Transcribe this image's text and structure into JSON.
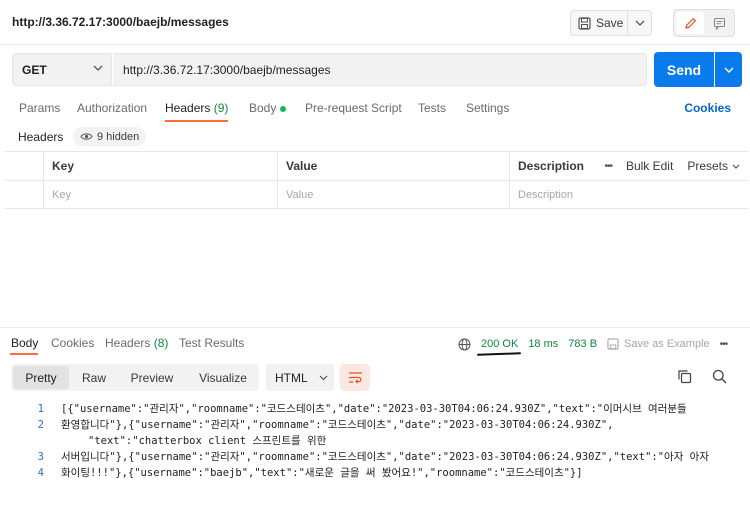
{
  "request": {
    "title": "http://3.36.72.17:3000/baejb/messages",
    "save_label": "Save",
    "method": "GET",
    "url": "http://3.36.72.17:3000/baejb/messages",
    "send_label": "Send"
  },
  "tabs": {
    "params": "Params",
    "authorization": "Authorization",
    "headers_label": "Headers",
    "headers_count": "(9)",
    "body": "Body",
    "pre_request": "Pre-request Script",
    "tests": "Tests",
    "settings": "Settings",
    "cookies": "Cookies"
  },
  "headers_sub": {
    "label": "Headers",
    "hidden": "9 hidden"
  },
  "header_table": {
    "col_key": "Key",
    "col_value": "Value",
    "col_description": "Description",
    "more": "•••",
    "bulk_edit": "Bulk Edit",
    "presets": "Presets",
    "key_placeholder": "Key",
    "value_placeholder": "Value",
    "description_placeholder": "Description"
  },
  "response": {
    "tabs": {
      "body": "Body",
      "cookies": "Cookies",
      "headers_label": "Headers",
      "headers_count": "(8)",
      "test_results": "Test Results"
    },
    "status": "200 OK",
    "time": "18 ms",
    "size": "783 B",
    "save_example": "Save as Example",
    "more": "•••",
    "views": {
      "pretty": "Pretty",
      "raw": "Raw",
      "preview": "Preview",
      "visualize": "Visualize"
    },
    "format": "HTML",
    "lines": [
      {
        "num": "1",
        "text": "[{\"username\":\"관리자\",\"roomname\":\"코드스테이츠\",\"date\":\"2023-03-30T04:06:24.930Z\",\"text\":\"이머시브 여러분들"
      },
      {
        "num": "",
        "text": "환영합니다\"},{\"username\":\"관리자\",\"roomname\":\"코드스테이츠\",\"date\":\"2023-03-30T04:06:24.930Z\","
      },
      {
        "num": "",
        "text": "\"text\":\"chatterbox client 스프린트를 위한"
      },
      {
        "num": "",
        "text": "서버입니다\"},{\"username\":\"관리자\",\"roomname\":\"코드스테이츠\",\"date\":\"2023-03-30T04:06:24.930Z\",\"text\":\"아자 아자"
      },
      {
        "num": "",
        "text": "화이팅!!!\"},{\"username\":\"baejb\",\"text\":\"새로운 글을 써 봤어요!\",\"roomname\":\"코드스테이츠\"}]"
      }
    ],
    "line_numbers": [
      "1",
      "2",
      "3",
      "4"
    ]
  },
  "colors": {
    "accent": "#ff6c37",
    "send": "#097bed",
    "status_ok": "#0c8a3c",
    "link": "#0265d2"
  }
}
